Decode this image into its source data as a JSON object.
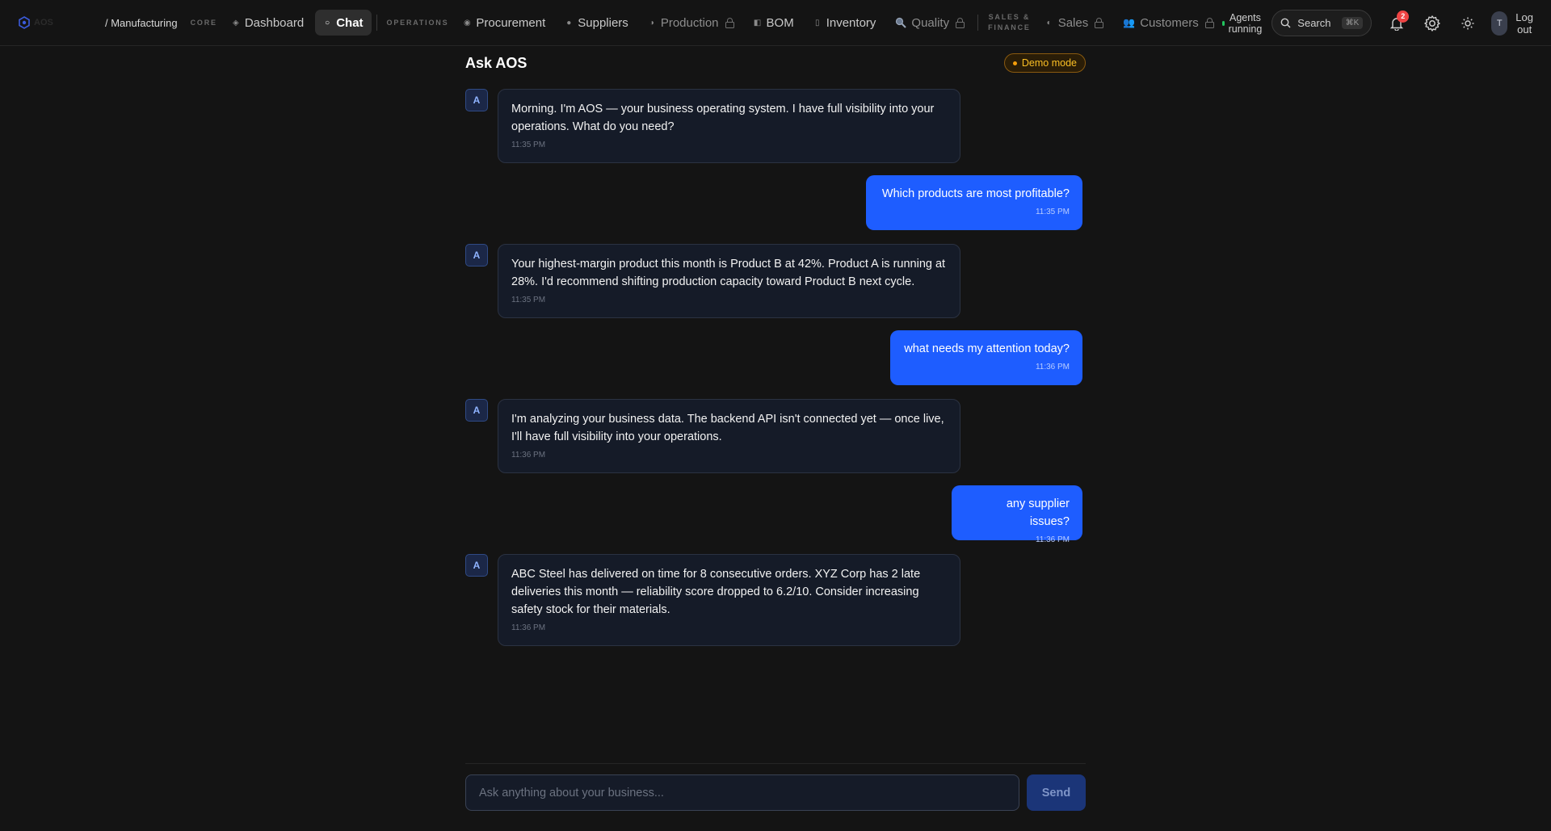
{
  "app": {
    "logo_text": "AOS",
    "breadcrumb": "/ Manufacturing"
  },
  "nav": {
    "core_label": "CORE",
    "operations_label": "OPERATIONS",
    "sales_label_1": "SALES &",
    "sales_label_2": "FINANCE",
    "items": {
      "dashboard": "Dashboard",
      "chat": "Chat",
      "procurement": "Procurement",
      "suppliers": "Suppliers",
      "production": "Production",
      "bom": "BOM",
      "inventory": "Inventory",
      "quality": "Quality",
      "sales": "Sales",
      "customers": "Customers"
    }
  },
  "toolbar": {
    "agents_line1": "Agents",
    "agents_line2": "running",
    "search_label": "Search",
    "search_shortcut": "⌘K",
    "notification_count": "2",
    "avatar_initial": "T",
    "logout_line1": "Log",
    "logout_line2": "out"
  },
  "chat": {
    "title": "Ask AOS",
    "demo_badge": "Demo mode",
    "ai_avatar": "A",
    "messages": [
      {
        "role": "assistant",
        "text": "Morning. I'm AOS — your business operating system. I have full visibility into your operations. What do you need?",
        "time": "11:35 PM"
      },
      {
        "role": "user",
        "text": "Which products are most profitable?",
        "time": "11:35 PM"
      },
      {
        "role": "assistant",
        "text": "Your highest-margin product this month is Product B at 42%. Product A is running at 28%. I'd recommend shifting production capacity toward Product B next cycle.",
        "time": "11:35 PM"
      },
      {
        "role": "user",
        "text": "what needs my attention today?",
        "time": "11:36 PM"
      },
      {
        "role": "assistant",
        "text": "I'm analyzing your business data. The backend API isn't connected yet — once live, I'll have full visibility into your operations.",
        "time": "11:36 PM"
      },
      {
        "role": "user",
        "text": "any supplier issues?",
        "time": "11:36 PM"
      },
      {
        "role": "assistant",
        "text": "ABC Steel has delivered on time for 8 consecutive orders. XYZ Corp has 2 late deliveries this month — reliability score dropped to 6.2/10. Consider increasing safety stock for their materials.",
        "time": "11:36 PM"
      }
    ],
    "input_placeholder": "Ask anything about your business...",
    "input_value": "",
    "send_label": "Send"
  },
  "colors": {
    "background": "#141414",
    "accent": "#1e5dff",
    "ai_bubble": "#151b28",
    "demo_badge": "#fbbf24",
    "notification": "#ef4444",
    "agents_status": "#22c55e"
  }
}
